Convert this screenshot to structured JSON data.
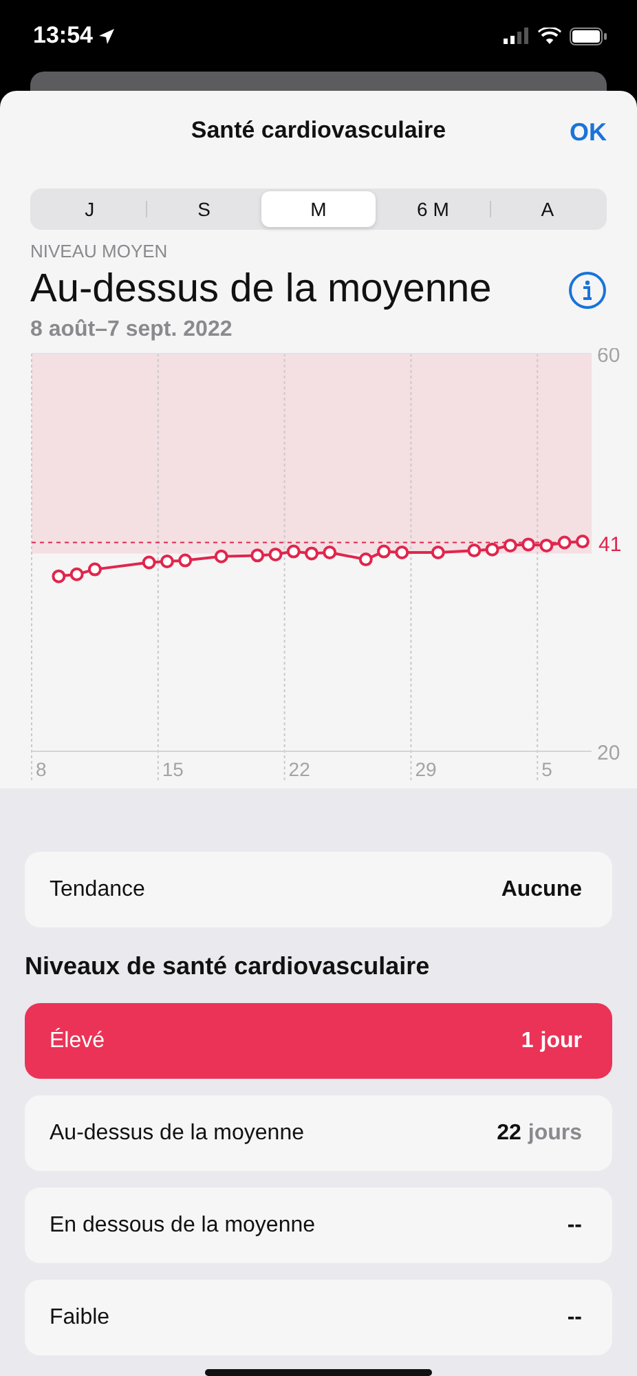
{
  "status_bar": {
    "time": "13:54"
  },
  "sheet": {
    "title": "Santé cardiovasculaire",
    "done": "OK"
  },
  "segments": [
    {
      "label": "J",
      "selected": false
    },
    {
      "label": "S",
      "selected": false
    },
    {
      "label": "M",
      "selected": true
    },
    {
      "label": "6 M",
      "selected": false
    },
    {
      "label": "A",
      "selected": false
    }
  ],
  "summary": {
    "caption": "NIVEAU MOYEN",
    "value": "Au-dessus de la moyenne",
    "range": "8 août–7 sept. 2022"
  },
  "chart_data": {
    "type": "line",
    "ylim": [
      20,
      60
    ],
    "yticks": [
      20,
      60
    ],
    "categories": [
      "8",
      null,
      null,
      null,
      null,
      null,
      null,
      "15",
      null,
      null,
      null,
      null,
      null,
      null,
      "22",
      null,
      null,
      null,
      null,
      null,
      null,
      "29",
      null,
      null,
      null,
      null,
      null,
      null,
      "5",
      null,
      null
    ],
    "series": [
      {
        "color": "#e0264d",
        "marker": "o",
        "values": [
          null,
          37.6,
          37.8,
          38.3,
          null,
          null,
          39.0,
          39.1,
          39.2,
          null,
          39.6,
          null,
          39.7,
          39.8,
          40.1,
          39.9,
          40.0,
          null,
          39.3,
          40.1,
          40.0,
          null,
          40.0,
          null,
          40.2,
          40.3,
          40.7,
          40.8,
          40.7,
          41.0,
          41.1
        ]
      }
    ],
    "ref_lines": [
      {
        "axis": "y",
        "value": 41,
        "label": "41",
        "color": "#e0264d"
      }
    ]
  },
  "trend": {
    "label": "Tendance",
    "value": "Aucune"
  },
  "levels_title": "Niveaux de santé cardiovasculaire",
  "levels": [
    {
      "label": "Élevé",
      "count": "1",
      "unit": "jour",
      "selected": true
    },
    {
      "label": "Au-dessus de la moyenne",
      "count": "22",
      "unit": "jours",
      "selected": false
    },
    {
      "label": "En dessous de la moyenne",
      "count": "--",
      "selected": false
    },
    {
      "label": "Faible",
      "count": "--",
      "selected": false
    }
  ]
}
